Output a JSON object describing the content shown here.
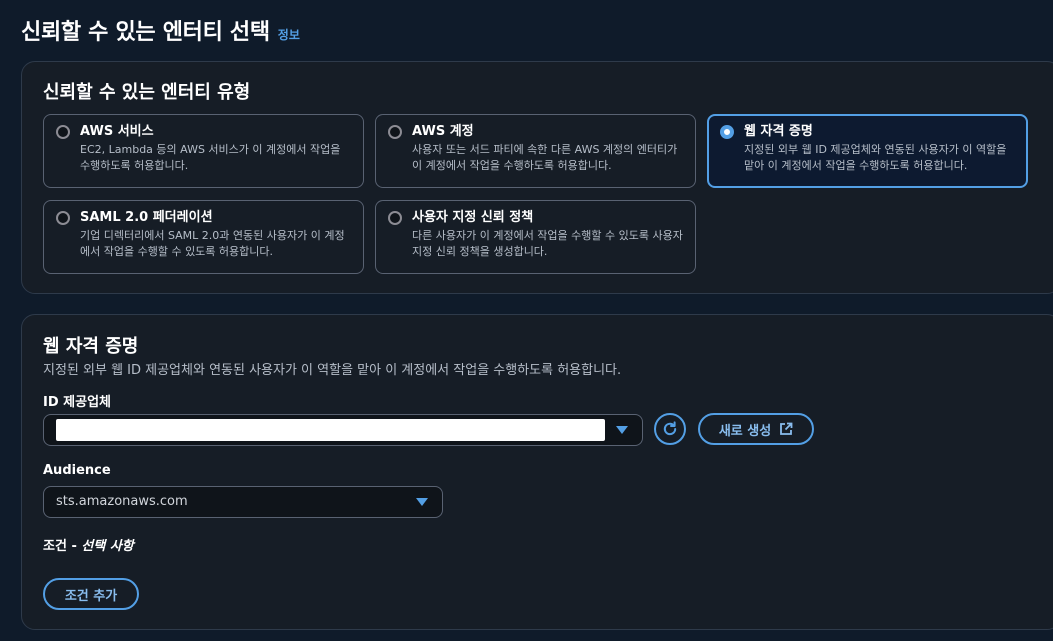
{
  "page": {
    "title": "신뢰할 수 있는 엔터티 선택",
    "info_link": "정보"
  },
  "entity_type": {
    "heading": "신뢰할 수 있는 엔터티 유형",
    "options": [
      {
        "label": "AWS 서비스",
        "description": "EC2, Lambda 등의 AWS 서비스가 이 계정에서 작업을 수행하도록 허용합니다.",
        "selected": false
      },
      {
        "label": "AWS 계정",
        "description": "사용자 또는 서드 파티에 속한 다른 AWS 계정의 엔터티가 이 계정에서 작업을 수행하도록 허용합니다.",
        "selected": false
      },
      {
        "label": "웹 자격 증명",
        "description": "지정된 외부 웹 ID 제공업체와 연동된 사용자가 이 역할을 맡아 이 계정에서 작업을 수행하도록 허용합니다.",
        "selected": true
      },
      {
        "label": "SAML 2.0 페더레이션",
        "description": "기업 디렉터리에서 SAML 2.0과 연동된 사용자가 이 계정에서 작업을 수행할 수 있도록 허용합니다.",
        "selected": false
      },
      {
        "label": "사용자 지정 신뢰 정책",
        "description": "다른 사용자가 이 계정에서 작업을 수행할 수 있도록 사용자 지정 신뢰 정책을 생성합니다.",
        "selected": false
      }
    ]
  },
  "web_identity": {
    "heading": "웹 자격 증명",
    "description": "지정된 외부 웹 ID 제공업체와 연동된 사용자가 이 역할을 맡아 이 계정에서 작업을 수행하도록 허용합니다.",
    "provider_label": "ID 제공업체",
    "provider_value": "",
    "new_button": "새로 생성",
    "audience_label": "Audience",
    "audience_value": "sts.amazonaws.com",
    "condition_label": "조건 - ",
    "condition_optional": "선택 사항",
    "add_condition_button": "조건 추가"
  },
  "colors": {
    "background": "#0f1b2a",
    "panel": "#161d26",
    "accent": "#539fe5",
    "selected_tile": "#0d1a30"
  },
  "icons": [
    "radio-icon",
    "chevron-down-icon",
    "refresh-icon",
    "external-link-icon"
  ]
}
